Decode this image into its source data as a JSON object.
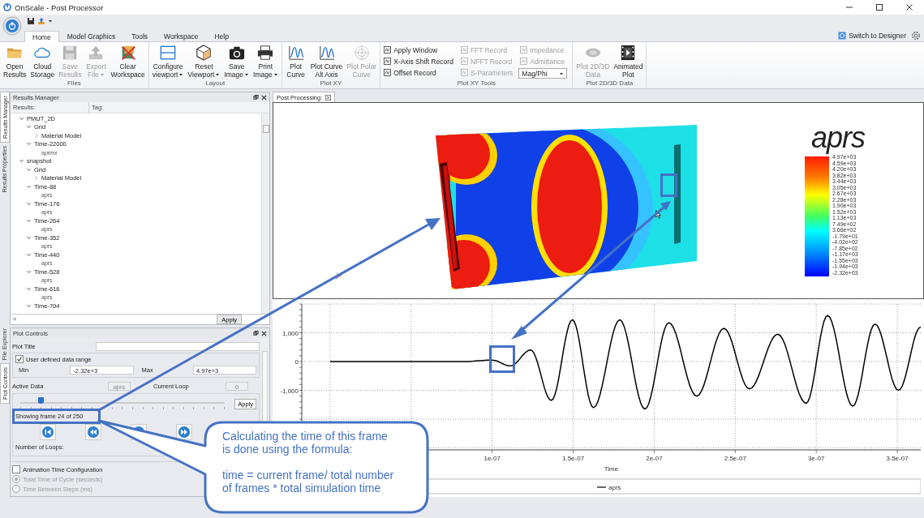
{
  "window": {
    "title": "OnScale - Post Processor"
  },
  "ribbon": {
    "tabs": [
      {
        "label": "Home",
        "selected": true
      },
      {
        "label": "Model Graphics",
        "selected": false
      },
      {
        "label": "Tools",
        "selected": false
      },
      {
        "label": "Workspace",
        "selected": false
      },
      {
        "label": "Help",
        "selected": false
      }
    ],
    "designer_link": "Switch to Designer",
    "groups": [
      {
        "label": "Files",
        "kind": "buttons",
        "buttons": [
          {
            "lines": [
              "Open",
              "Results"
            ],
            "disabled": false,
            "dropdown": false
          },
          {
            "lines": [
              "Cloud",
              "Storage"
            ],
            "disabled": false,
            "dropdown": false
          },
          {
            "lines": [
              "Save",
              "Results"
            ],
            "disabled": true,
            "dropdown": false
          },
          {
            "lines": [
              "Export",
              "File"
            ],
            "disabled": true,
            "dropdown": true
          },
          {
            "lines": [
              "Clear",
              "Workspace"
            ],
            "disabled": false,
            "dropdown": false
          }
        ]
      },
      {
        "label": "Layout",
        "kind": "buttons",
        "buttons": [
          {
            "lines": [
              "Configure",
              "viewport"
            ],
            "disabled": false,
            "dropdown": true
          },
          {
            "lines": [
              "Reset",
              "Viewport"
            ],
            "disabled": false,
            "dropdown": true
          },
          {
            "lines": [
              "Save",
              "Image"
            ],
            "disabled": false,
            "dropdown": true
          },
          {
            "lines": [
              "Print",
              "Image"
            ],
            "disabled": false,
            "dropdown": true
          }
        ]
      },
      {
        "label": "Plot XY",
        "kind": "buttons",
        "buttons": [
          {
            "lines": [
              "Plot",
              "Curve"
            ],
            "disabled": false,
            "dropdown": false
          },
          {
            "lines": [
              "Plot Curve",
              "Alt Axis"
            ],
            "disabled": false,
            "dropdown": false
          },
          {
            "lines": [
              "Plot Polar",
              "Curve"
            ],
            "disabled": true,
            "dropdown": false
          }
        ]
      },
      {
        "label": "Plot XY Tools",
        "kind": "tools",
        "columns": [
          [
            {
              "kind": "tool",
              "label": "Apply Window",
              "disabled": false
            },
            {
              "kind": "tool",
              "label": "X-Axis Shift Record",
              "disabled": false
            },
            {
              "kind": "tool",
              "label": "Offset Record",
              "disabled": false
            }
          ],
          [
            {
              "kind": "tool",
              "label": "FFT Record",
              "disabled": true
            },
            {
              "kind": "tool",
              "label": "NFFT Record",
              "disabled": true
            },
            {
              "kind": "tool",
              "label": "S-Parameters",
              "disabled": true
            }
          ],
          [
            {
              "kind": "tool",
              "label": "Impedance",
              "disabled": true
            },
            {
              "kind": "tool",
              "label": "Admittance",
              "disabled": true
            },
            {
              "kind": "combo",
              "value": "Mag/Phi"
            }
          ]
        ]
      },
      {
        "label": "Plot 2D/3D Data",
        "kind": "buttons",
        "buttons": [
          {
            "lines": [
              "Plot 2D/3D",
              "Data"
            ],
            "disabled": true,
            "dropdown": false
          },
          {
            "lines": [
              "Animated",
              "Plot"
            ],
            "disabled": false,
            "dropdown": false
          }
        ]
      }
    ]
  },
  "side_tabs_top": [
    {
      "label": "Results Manager",
      "selected": true
    },
    {
      "label": "Results Properties",
      "selected": false
    }
  ],
  "results_manager": {
    "title": "Results Manager",
    "columns": [
      "Results:",
      "Tag:"
    ],
    "tree": [
      {
        "label": "PMUT_2D",
        "expanded": true,
        "children": [
          {
            "label": "Grid",
            "expanded": true,
            "children": [
              {
                "label": "Material Model",
                "expanded": false
              }
            ]
          },
          {
            "label": "Time-22000",
            "expanded": true,
            "children": [
              {
                "label": "aprmx"
              }
            ]
          }
        ]
      },
      {
        "label": "snapshot",
        "expanded": true,
        "children": [
          {
            "label": "Grid",
            "expanded": true,
            "children": [
              {
                "label": "Material Model",
                "expanded": false
              }
            ]
          },
          {
            "label": "Time-88",
            "expanded": true,
            "children": [
              {
                "label": "aprs"
              }
            ]
          },
          {
            "label": "Time-176",
            "expanded": true,
            "children": [
              {
                "label": "aprs"
              }
            ]
          },
          {
            "label": "Time-264",
            "expanded": true,
            "children": [
              {
                "label": "aprs"
              }
            ]
          },
          {
            "label": "Time-352",
            "expanded": true,
            "children": [
              {
                "label": "aprs"
              }
            ]
          },
          {
            "label": "Time-440",
            "expanded": true,
            "children": [
              {
                "label": "aprs"
              }
            ]
          },
          {
            "label": "Time-528",
            "expanded": true,
            "children": [
              {
                "label": "aprs"
              }
            ]
          },
          {
            "label": "Time-616",
            "expanded": true,
            "children": [
              {
                "label": "aprs"
              }
            ]
          },
          {
            "label": "Time-704",
            "expanded": true
          }
        ]
      }
    ],
    "filter": "=",
    "apply": "Apply"
  },
  "side_tabs_bottom": [
    {
      "label": "File Explorer",
      "selected": false
    },
    {
      "label": "Plot Controls",
      "selected": true
    }
  ],
  "plot_controls": {
    "title": "Plot Controls",
    "plot_title_label": "Plot Title",
    "user_range": {
      "label": "User defined data range",
      "checked": true
    },
    "min_label": "Min",
    "min": "-2.32e+3",
    "max_label": "Max",
    "max": "4.97e+3",
    "active_data_label": "Active Data",
    "active_data": "aprs",
    "current_loop_label": "Current Loop",
    "current_loop": "0",
    "frame_slider": {
      "level": 0.1
    },
    "apply": "Apply",
    "frame_text": "Showing frame 24 of 250",
    "loops_label": "Number of Loops:",
    "animation": {
      "label": "Animation Time Configuration",
      "checked": false
    },
    "radios": [
      {
        "label": "Total Time of Cycle (seconds)",
        "selected": true,
        "disabled": true
      },
      {
        "label": "Time Between Steps (ms)",
        "selected": false,
        "disabled": true
      }
    ]
  },
  "doc_tab": {
    "label": "Post Processing:"
  },
  "view": {
    "colorbar_title": "aprs",
    "colorbar_labels": [
      "4.97e+03",
      "4.59e+03",
      "4.20e+03",
      "3.82e+03",
      "3.44e+03",
      "3.05e+03",
      "2.67e+03",
      "2.28e+03",
      "1.90e+03",
      "1.52e+03",
      "1.13e+03",
      "7.49e+02",
      "3.66e+02",
      "-1.79e+01",
      "-4.02e+02",
      "-7.85e+02",
      "-1.17e+03",
      "-1.55e+03",
      "-1.94e+03",
      "-2.32e+03"
    ]
  },
  "chart": {
    "chart_data": {
      "type": "line",
      "xlabel": "Time",
      "x": [
        0,
        8.25e-08,
        1e-07,
        1.1125e-07,
        1.2375e-07,
        1.365e-07,
        1.495e-07,
        1.625e-07,
        1.7875e-07,
        1.9425e-07,
        2.09e-07,
        2.2625e-07,
        2.43e-07,
        2.5875e-07,
        2.7625e-07,
        2.9375e-07,
        3.07e-07,
        3.225e-07,
        3.3625e-07,
        3.5075e-07,
        3.645e-07
      ],
      "series": [
        {
          "name": "aprs",
          "color": "#000000",
          "values": [
            0,
            0,
            50,
            -150,
            400,
            -1350,
            1450,
            -1600,
            1450,
            -1650,
            1350,
            -1200,
            1150,
            -950,
            950,
            -1450,
            1600,
            -1550,
            1300,
            -1000,
            1200
          ]
        }
      ],
      "grid": true,
      "xlim": [
        -1.75e-08,
        3.645e-07
      ],
      "ylim": [
        -3070,
        2000
      ],
      "xticks": [
        {
          "value": 1e-07,
          "label": "1e-07"
        },
        {
          "value": 1.5e-07,
          "label": "1.5e-07"
        },
        {
          "value": 2e-07,
          "label": "2e-07"
        },
        {
          "value": 2.5e-07,
          "label": "2.5e-07"
        },
        {
          "value": 3e-07,
          "label": "3e-07"
        },
        {
          "value": 3.5e-07,
          "label": "3.5e-07"
        }
      ],
      "yticks": [
        {
          "value": 1000,
          "label": "1,000"
        },
        {
          "value": 0,
          "label": "0"
        },
        {
          "value": -1000,
          "label": "-1,000"
        }
      ]
    }
  },
  "callout": {
    "paragraphs": [
      [
        "Calculating the time of this frame",
        "is done using the formula:"
      ],
      [
        "time = current frame/ total number",
        "of frames * total simulation time"
      ]
    ]
  }
}
